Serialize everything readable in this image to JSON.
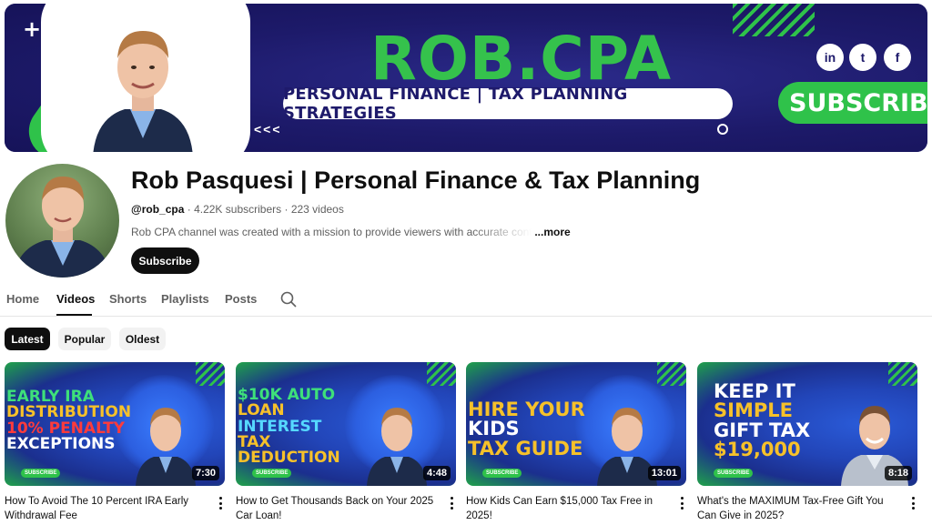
{
  "banner": {
    "title": "ROB.CPA",
    "tagline": "PERSONAL FINANCE | TAX PLANNING STRATEGIES",
    "subscribe_label": "SUBSCRIBE",
    "plus_glyph": "+",
    "arrows_glyph": "<<<",
    "social": [
      {
        "icon": "linkedin-icon",
        "glyph": "in"
      },
      {
        "icon": "twitter-icon",
        "glyph": "t"
      },
      {
        "icon": "facebook-icon",
        "glyph": "f"
      }
    ],
    "colors": {
      "navy": "#1e1a6b",
      "green": "#35c24c"
    }
  },
  "channel": {
    "name": "Rob Pasquesi | Personal Finance & Tax Planning",
    "handle": "@rob_cpa",
    "subscribers": "4.22K subscribers",
    "videos_count": "223 videos",
    "separator": "·",
    "description": "Rob CPA channel was created with a mission to provide viewers with accurate content so",
    "more_label": "...more",
    "subscribe_label": "Subscribe"
  },
  "tabs": [
    {
      "label": "Home",
      "active": false
    },
    {
      "label": "Videos",
      "active": true
    },
    {
      "label": "Shorts",
      "active": false
    },
    {
      "label": "Playlists",
      "active": false
    },
    {
      "label": "Posts",
      "active": false
    }
  ],
  "chips": [
    {
      "label": "Latest",
      "active": true
    },
    {
      "label": "Popular",
      "active": false
    },
    {
      "label": "Oldest",
      "active": false
    }
  ],
  "videos": [
    {
      "title": "How To Avoid The 10 Percent IRA Early Withdrawal Fee",
      "duration": "7:30",
      "thumb_lines": [
        {
          "text": "EARLY IRA",
          "color": "#3ee07a"
        },
        {
          "text": "DISTRIBUTION",
          "color": "#f6c12a"
        },
        {
          "text": "10% PENALTY",
          "color": "#ff3b3b"
        },
        {
          "text": "EXCEPTIONS",
          "color": "#ffffff"
        }
      ],
      "thumb_sub": "SUBSCRIBE"
    },
    {
      "title": "How to Get Thousands Back on Your 2025 Car Loan!",
      "duration": "4:48",
      "thumb_lines": [
        {
          "text": "$10K AUTO",
          "color": "#3ee07a"
        },
        {
          "text": "LOAN",
          "color": "#f6c12a"
        },
        {
          "text": "INTEREST",
          "color": "#56d8ff"
        },
        {
          "text": "TAX",
          "color": "#f6c12a"
        },
        {
          "text": "DEDUCTION",
          "color": "#f6c12a"
        }
      ],
      "thumb_sub": "SUBSCRIBE"
    },
    {
      "title": "How Kids Can Earn $15,000 Tax Free in 2025!",
      "duration": "13:01",
      "thumb_lines": [
        {
          "text": "HIRE YOUR",
          "color": "#f6c12a"
        },
        {
          "text": "KIDS",
          "color": "#ffffff"
        },
        {
          "text": "TAX GUIDE",
          "color": "#f6c12a"
        }
      ],
      "thumb_sub": "SUBSCRIBE"
    },
    {
      "title": "What's the MAXIMUM Tax-Free Gift You Can Give in 2025?",
      "duration": "8:18",
      "thumb_lines": [
        {
          "text": "KEEP IT",
          "color": "#ffffff"
        },
        {
          "text": "SIMPLE",
          "color": "#f6c12a"
        },
        {
          "text": "GIFT TAX",
          "color": "#ffffff"
        },
        {
          "text": "$19,000",
          "color": "#f6c12a"
        }
      ],
      "thumb_sub": "SUBSCRIBE"
    }
  ]
}
